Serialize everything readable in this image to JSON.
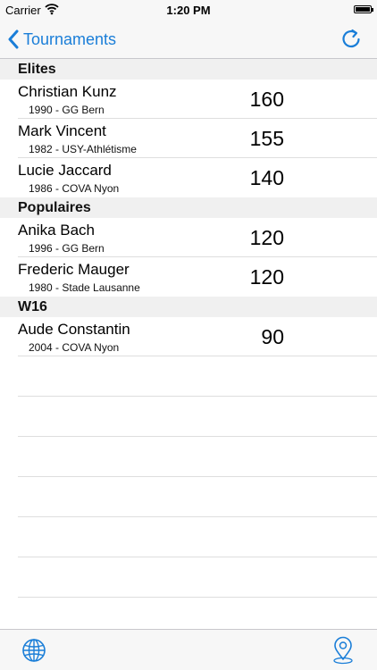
{
  "status_bar": {
    "carrier": "Carrier",
    "time": "1:20 PM",
    "wifi_icon": "wifi-icon",
    "battery_icon": "battery-icon"
  },
  "nav": {
    "back_label": "Tournaments",
    "back_icon": "chevron-left-icon",
    "refresh_icon": "refresh-icon"
  },
  "colors": {
    "accent": "#1a7ed8",
    "section_bg": "#f0f0f0",
    "separator": "#dedede"
  },
  "sections": [
    {
      "title": "Elites",
      "rows": [
        {
          "name": "Christian Kunz",
          "sub": "1990 - GG Bern",
          "score": "160"
        },
        {
          "name": "Mark Vincent",
          "sub": "1982 - USY-Athlétisme",
          "score": "155"
        },
        {
          "name": "Lucie Jaccard",
          "sub": "1986 - COVA Nyon",
          "score": "140"
        }
      ]
    },
    {
      "title": "Populaires",
      "rows": [
        {
          "name": "Anika Bach",
          "sub": "1996 - GG Bern",
          "score": "120"
        },
        {
          "name": "Frederic Mauger",
          "sub": "1980 - Stade Lausanne",
          "score": "120"
        }
      ]
    },
    {
      "title": "W16",
      "rows": [
        {
          "name": "Aude Constantin",
          "sub": "2004 - COVA Nyon",
          "score": "90"
        }
      ]
    }
  ],
  "tab_bar": {
    "left_icon": "globe-icon",
    "right_icon": "location-pin-icon"
  }
}
